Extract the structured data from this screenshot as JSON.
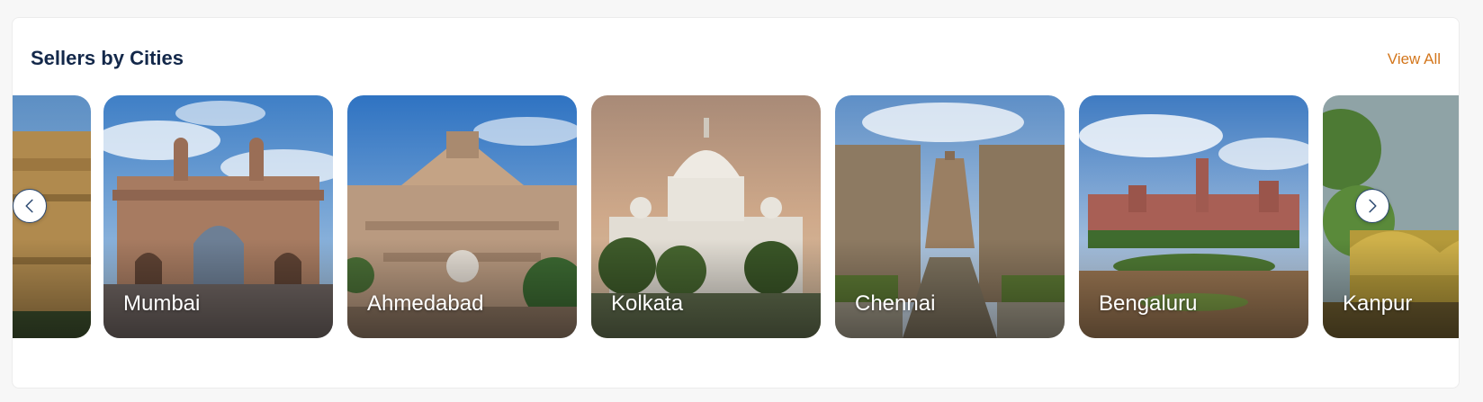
{
  "section": {
    "title": "Sellers by Cities",
    "view_all_label": "View All"
  },
  "carousel": {
    "prev_icon": "chevron-left-icon",
    "next_icon": "chevron-right-icon",
    "cities": [
      {
        "name": "",
        "landmark": "india-gate"
      },
      {
        "name": "Mumbai",
        "landmark": "gateway-of-india"
      },
      {
        "name": "Ahmedabad",
        "landmark": "temple"
      },
      {
        "name": "Kolkata",
        "landmark": "victoria-memorial"
      },
      {
        "name": "Chennai",
        "landmark": "temple-gopuram"
      },
      {
        "name": "Bengaluru",
        "landmark": "bangalore-palace"
      },
      {
        "name": "Kanpur",
        "landmark": "city-landmark"
      }
    ]
  },
  "colors": {
    "title": "#13284a",
    "link": "#d3761c",
    "nav_border": "#2d4a72"
  }
}
